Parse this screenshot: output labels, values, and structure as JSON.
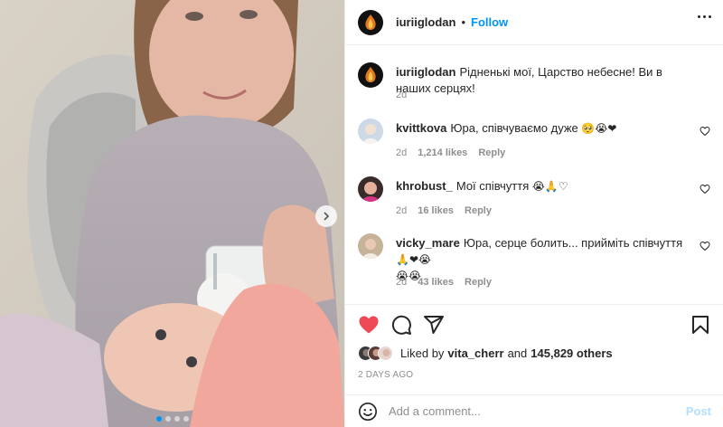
{
  "post": {
    "author": "iuriiglodan",
    "separator": "•",
    "follow_label": "Follow",
    "more_label": "More options",
    "image_alt": "Photo of a woman bottle-feeding a baby",
    "carousel": {
      "total": 4,
      "active": 1
    }
  },
  "caption": {
    "username": "iuriiglodan",
    "text": "Рідненькі мої, Царство небесне! Ви в наших серцях!",
    "age": "2d"
  },
  "comments": [
    {
      "username": "kvittkova",
      "text": "Юра, співчуваємо дуже",
      "emoji": "🥺😭❤",
      "age": "2d",
      "likes": "1,214 likes",
      "reply": "Reply"
    },
    {
      "username": "khrobust_",
      "text": "Мої співчуття",
      "emoji": "😭🙏♡",
      "age": "2d",
      "likes": "16 likes",
      "reply": "Reply"
    },
    {
      "username": "vicky_mare",
      "text": "Юра, серце болить... прийміть співчуття",
      "emoji": "🙏❤😭",
      "emoji2": "😭😭",
      "age": "2d",
      "likes": "43 likes",
      "reply": "Reply"
    }
  ],
  "likes": {
    "prefix": "Liked by",
    "user": "vita_cherr",
    "joiner": "and",
    "count": "145,829 others"
  },
  "timestamp": "2 DAYS AGO",
  "add_comment": {
    "placeholder": "Add a comment...",
    "post_label": "Post"
  },
  "colors": {
    "accent": "#0095f6",
    "like_red": "#ed4956",
    "muted": "#8e8e8e",
    "post_disabled": "#b2dffc"
  },
  "icons": {
    "like": "heart-filled-icon",
    "comment": "comment-icon",
    "share": "paper-plane-icon",
    "save": "bookmark-icon",
    "emoji": "smiley-icon",
    "next": "chevron-right-icon",
    "more": "more-dots-icon"
  }
}
